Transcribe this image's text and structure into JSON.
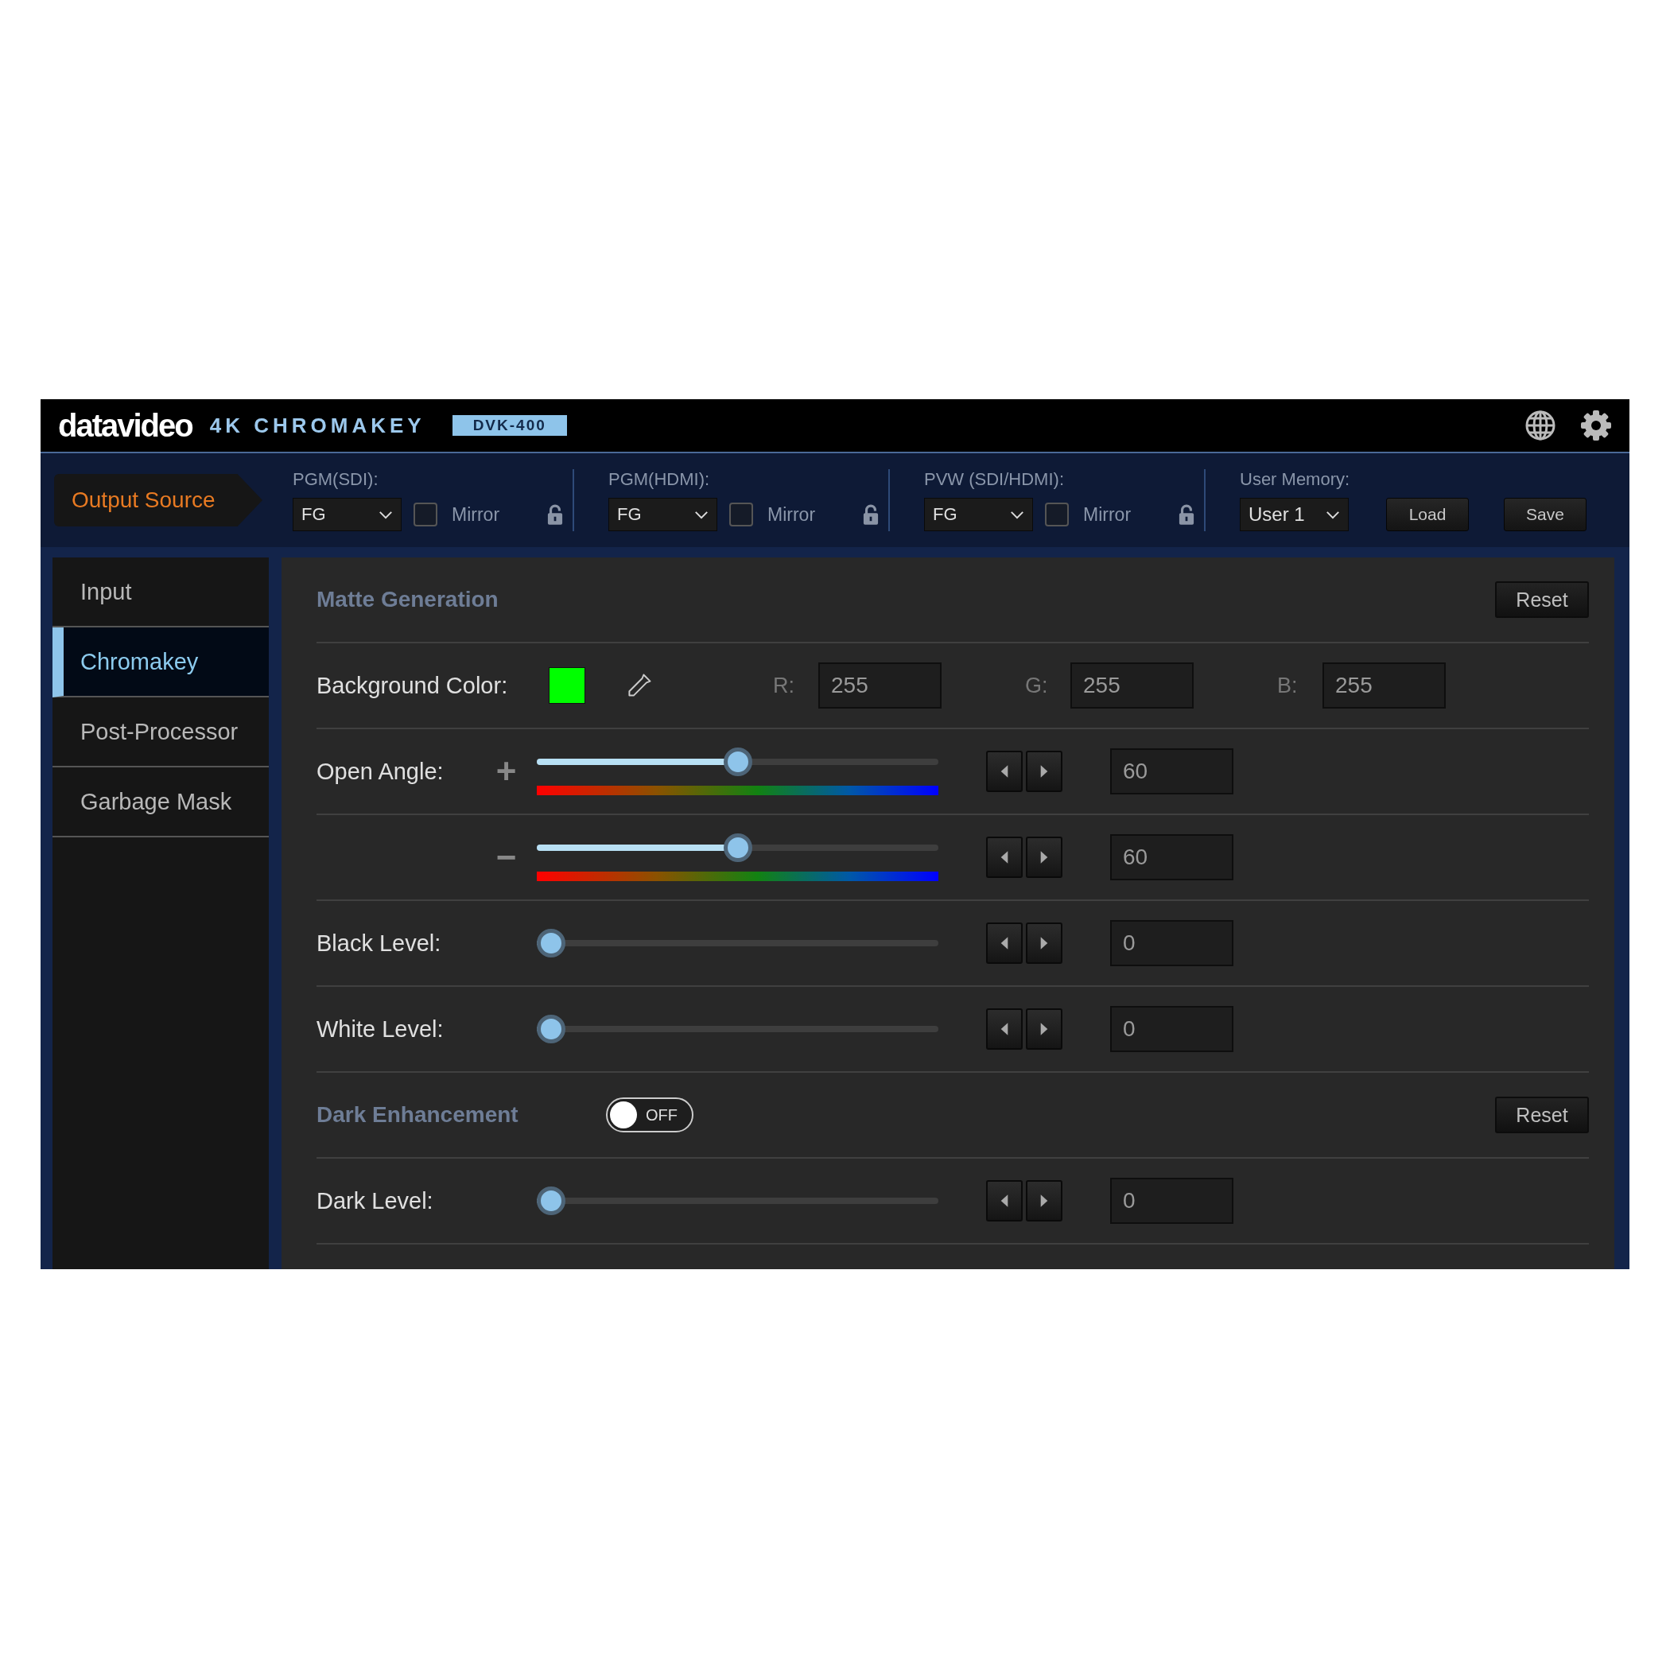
{
  "header": {
    "logo": "datavideo",
    "product": "4K CHROMAKEY",
    "model": "DVK-400"
  },
  "toolbar": {
    "section": "Output Source",
    "outputs": [
      {
        "label": "PGM(SDI):",
        "value": "FG",
        "mirror_label": "Mirror",
        "mirror_checked": false,
        "locked": false
      },
      {
        "label": "PGM(HDMI):",
        "value": "FG",
        "mirror_label": "Mirror",
        "mirror_checked": false,
        "locked": false
      },
      {
        "label": "PVW (SDI/HDMI):",
        "value": "FG",
        "mirror_label": "Mirror",
        "mirror_checked": false,
        "locked": false
      }
    ],
    "user_memory": {
      "label": "User Memory:",
      "value": "User 1",
      "buttons": [
        "Load",
        "Save"
      ]
    }
  },
  "sidebar": {
    "items": [
      {
        "label": "Input",
        "selected": false
      },
      {
        "label": "Chromakey",
        "selected": true
      },
      {
        "label": "Post-Processor",
        "selected": false
      },
      {
        "label": "Garbage Mask",
        "selected": false
      }
    ]
  },
  "sections": [
    {
      "title": "Matte Generation",
      "button": "Reset",
      "rows": [
        {
          "kind": "color",
          "label": "Background Color:",
          "color": "#00ff00",
          "channels": [
            {
              "label": "R:",
              "value": "255"
            },
            {
              "label": "G:",
              "value": "255"
            },
            {
              "label": "B:",
              "value": "255"
            }
          ]
        },
        {
          "kind": "hue_slider",
          "label": "Open Angle:",
          "sign": "+",
          "level": 0.5,
          "value": "60"
        },
        {
          "kind": "hue_slider",
          "sign": "−",
          "level": 0.5,
          "value": "60"
        },
        {
          "kind": "slider",
          "label": "Black Level:",
          "level": 0,
          "value": "0"
        },
        {
          "kind": "slider",
          "label": "White Level:",
          "level": 0,
          "value": "0"
        }
      ]
    },
    {
      "title": "Dark Enhancement",
      "toggle": {
        "label": "OFF",
        "on": false
      },
      "button": "Reset",
      "rows": [
        {
          "kind": "slider",
          "label": "Dark Level:",
          "level": 0,
          "value": "0"
        }
      ]
    }
  ]
}
